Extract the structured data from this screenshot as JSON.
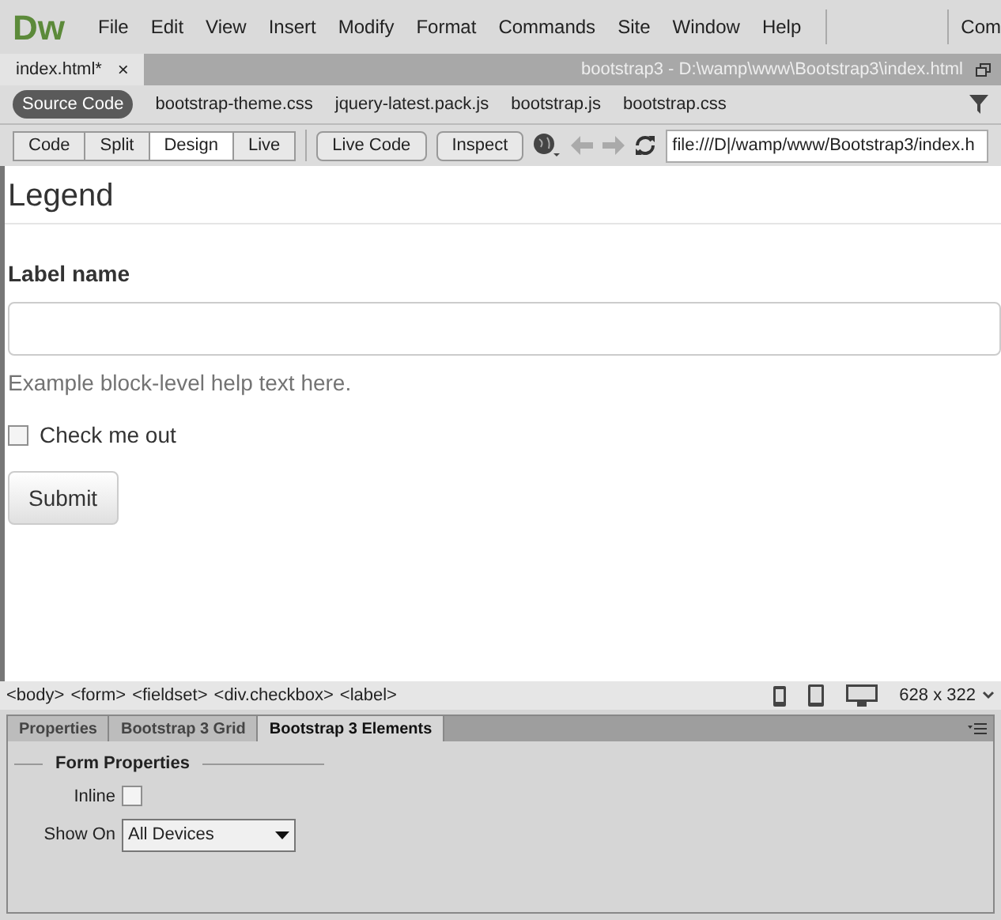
{
  "app": {
    "logo": "Dw",
    "menu": [
      "File",
      "Edit",
      "View",
      "Insert",
      "Modify",
      "Format",
      "Commands",
      "Site",
      "Window",
      "Help"
    ],
    "workspace": "Com"
  },
  "document_tab": {
    "label": "index.html*",
    "close": "×",
    "path": "bootstrap3 - D:\\wamp\\www\\Bootstrap3\\index.html"
  },
  "related_files": [
    {
      "label": "Source Code",
      "selected": true
    },
    {
      "label": "bootstrap-theme.css",
      "selected": false
    },
    {
      "label": "jquery-latest.pack.js",
      "selected": false
    },
    {
      "label": "bootstrap.js",
      "selected": false
    },
    {
      "label": "bootstrap.css",
      "selected": false
    }
  ],
  "view_buttons": [
    {
      "label": "Code",
      "selected": false
    },
    {
      "label": "Split",
      "selected": false
    },
    {
      "label": "Design",
      "selected": true
    },
    {
      "label": "Live",
      "selected": false
    }
  ],
  "live_buttons": [
    "Live Code",
    "Inspect"
  ],
  "address": "file:///D|/wamp/www/Bootstrap3/index.h",
  "design": {
    "legend": "Legend",
    "label": "Label name",
    "help": "Example block-level help text here.",
    "checkbox": {
      "label": "Check me out",
      "checked": false
    },
    "submit": "Submit"
  },
  "tag_selector": [
    "<body>",
    "<form>",
    "<fieldset>",
    "<div.checkbox>",
    "<label>"
  ],
  "window_size": "628 x 322",
  "panel_tabs": [
    {
      "label": "Properties",
      "selected": false
    },
    {
      "label": "Bootstrap 3 Grid",
      "selected": false
    },
    {
      "label": "Bootstrap 3 Elements",
      "selected": true
    }
  ],
  "form_properties": {
    "title": "Form Properties",
    "inline_label": "Inline",
    "inline_checked": false,
    "show_on_label": "Show On",
    "show_on_value": "All Devices"
  }
}
